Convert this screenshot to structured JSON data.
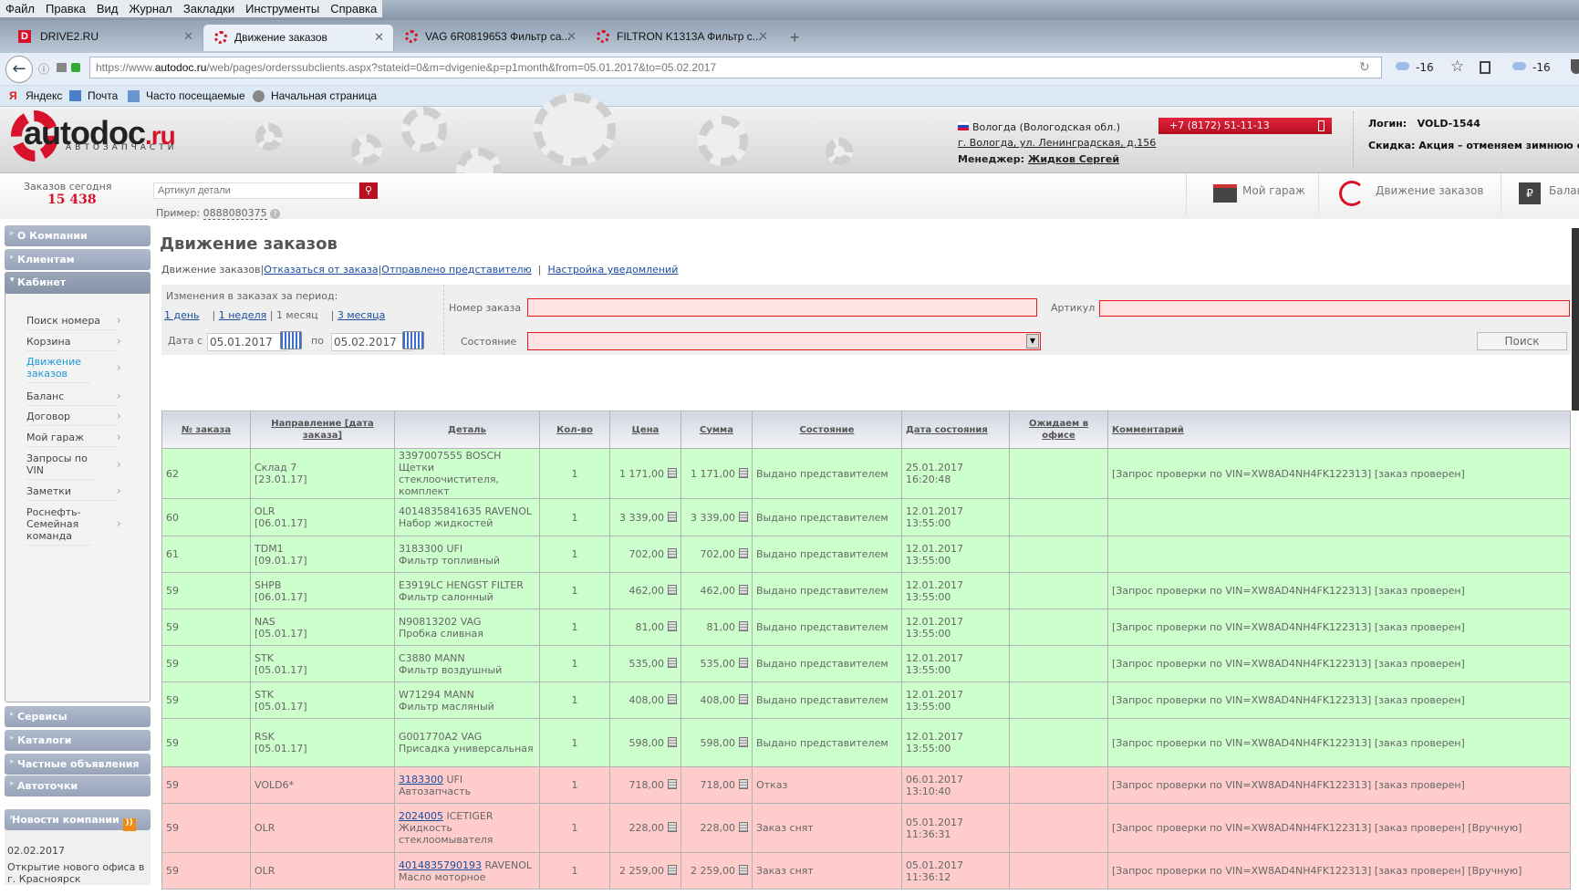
{
  "browser": {
    "menu": [
      "Файл",
      "Правка",
      "Вид",
      "Журнал",
      "Закладки",
      "Инструменты",
      "Справка"
    ],
    "tabs": [
      {
        "label": "DRIVE2.RU",
        "icon": "D"
      },
      {
        "label": "Движение заказов"
      },
      {
        "label": "VAG 6R0819653 Фильтр са..."
      },
      {
        "label": "FILTRON K1313A Фильтр с..."
      }
    ],
    "new_tab": "+",
    "url_prefix": "https://www.",
    "url_host": "autodoc.ru",
    "url_rest": "/web/pages/orderssubclients.aspx?stateid=0&m=dvigenie&p=p1month&from=05.01.2017&to=05.02.2017",
    "weather1": "-16",
    "weather2": "-16",
    "bookmarks": [
      "Яндекс",
      "Почта",
      "Часто посещаемые",
      "Начальная страница"
    ]
  },
  "site": {
    "logo_main": "autodoc",
    "logo_ru": ".ru",
    "logo_sub": "АВТОЗАПЧАСТИ",
    "city": "Вологда (Вологодская обл.)",
    "address": "г. Вологда, ул. Ленинградская, д.156",
    "manager_label": "Менеджер:",
    "manager": "Жидков Сергей",
    "phone": "+7 (8172) 51-11-13",
    "login_label": "Логин:",
    "login": "VOLD-1544",
    "discount_label": "Скидка:",
    "discount": "Акция – отменяем зимнюю спя",
    "orders_today_label": "Заказов сегодня",
    "orders_today": "15 438",
    "search_placeholder": "Артикул детали",
    "example_label": "Пример:",
    "example": "0888080375",
    "top_links": [
      "Мой гараж",
      "Движение заказов",
      "Балан"
    ]
  },
  "sidebar": {
    "sections_top": [
      "О Компании",
      "Клиентам",
      "Кабинет"
    ],
    "items": [
      "Поиск номера",
      "Корзина",
      "Движение заказов",
      "Баланс",
      "Договор",
      "Мой гараж",
      "Запросы по VIN",
      "Заметки",
      "Роснефть-Семейная команда"
    ],
    "sections_bottom": [
      "Сервисы",
      "Каталоги",
      "Частные объявления",
      "Автоточки"
    ],
    "news_title": "Новости компании",
    "news_date": "02.02.2017",
    "news_text": "Открытие нового офиса в г. Красноярск"
  },
  "page": {
    "title": "Движение заказов",
    "subnav": [
      "Движение заказов",
      "Отказаться от заказа",
      "Отправлено представителю",
      "Настройка уведомлений"
    ],
    "period_label": "Изменения в заказах за период:",
    "periods": [
      "1 день",
      "1 неделя",
      "1 месяц",
      "3 месяца"
    ],
    "date_from_label": "Дата с",
    "date_from": "05.01.2017",
    "date_to_label": "по",
    "date_to": "05.02.2017",
    "order_no_label": "Номер заказа",
    "article_label": "Артикул",
    "state_label": "Состояние",
    "search_button": "Поиск"
  },
  "table": {
    "headers": [
      "№ заказа",
      "Направление [дата заказа]",
      "Деталь",
      "Кол-во",
      "Цена",
      "Сумма",
      "Состояние",
      "Дата состояния",
      "Ожидаем в офисе",
      "Комментарий"
    ],
    "rows": [
      {
        "status": "ok",
        "no": "62",
        "dir": "Склад 7",
        "dir_date": "[23.01.17]",
        "part_no": "",
        "part_brand": "3397007555 BOSCH",
        "part_name": "Щетки стеклоочистителя, комплект",
        "qty": "1",
        "price": "1 171,00",
        "sum": "1 171,00",
        "state": "Выдано представителем",
        "date": "25.01.2017",
        "time": "16:20:48",
        "wait": "",
        "comment": "[Запрос проверки по VIN=XW8AD4NH4FK122313] [заказ проверен]"
      },
      {
        "status": "ok",
        "no": "60",
        "dir": "OLR",
        "dir_date": "[06.01.17]",
        "part_no": "",
        "part_brand": "4014835841635 RAVENOL",
        "part_name": "Набор жидкостей",
        "qty": "1",
        "price": "3 339,00",
        "sum": "3 339,00",
        "state": "Выдано представителем",
        "date": "12.01.2017",
        "time": "13:55:00",
        "wait": "",
        "comment": ""
      },
      {
        "status": "ok",
        "no": "61",
        "dir": "TDM1",
        "dir_date": "[09.01.17]",
        "part_no": "",
        "part_brand": "3183300 UFI",
        "part_name": "Фильтр топливный",
        "qty": "1",
        "price": "702,00",
        "sum": "702,00",
        "state": "Выдано представителем",
        "date": "12.01.2017",
        "time": "13:55:00",
        "wait": "",
        "comment": ""
      },
      {
        "status": "ok",
        "no": "59",
        "dir": "SHPB",
        "dir_date": "[06.01.17]",
        "part_no": "",
        "part_brand": "E3919LC HENGST FILTER",
        "part_name": "Фильтр салонный",
        "qty": "1",
        "price": "462,00",
        "sum": "462,00",
        "state": "Выдано представителем",
        "date": "12.01.2017",
        "time": "13:55:00",
        "wait": "",
        "comment": "[Запрос проверки по VIN=XW8AD4NH4FK122313] [заказ проверен]"
      },
      {
        "status": "ok",
        "no": "59",
        "dir": "NAS",
        "dir_date": "[05.01.17]",
        "part_no": "",
        "part_brand": "N90813202 VAG",
        "part_name": "Пробка сливная",
        "qty": "1",
        "price": "81,00",
        "sum": "81,00",
        "state": "Выдано представителем",
        "date": "12.01.2017",
        "time": "13:55:00",
        "wait": "",
        "comment": "[Запрос проверки по VIN=XW8AD4NH4FK122313] [заказ проверен]"
      },
      {
        "status": "ok",
        "no": "59",
        "dir": "STK",
        "dir_date": "[05.01.17]",
        "part_no": "",
        "part_brand": "C3880 MANN",
        "part_name": "Фильтр воздушный",
        "qty": "1",
        "price": "535,00",
        "sum": "535,00",
        "state": "Выдано представителем",
        "date": "12.01.2017",
        "time": "13:55:00",
        "wait": "",
        "comment": "[Запрос проверки по VIN=XW8AD4NH4FK122313] [заказ проверен]"
      },
      {
        "status": "ok",
        "no": "59",
        "dir": "STK",
        "dir_date": "[05.01.17]",
        "part_no": "",
        "part_brand": "W71294 MANN",
        "part_name": "Фильтр масляный",
        "qty": "1",
        "price": "408,00",
        "sum": "408,00",
        "state": "Выдано представителем",
        "date": "12.01.2017",
        "time": "13:55:00",
        "wait": "",
        "comment": "[Запрос проверки по VIN=XW8AD4NH4FK122313] [заказ проверен]"
      },
      {
        "status": "ok",
        "no": "59",
        "dir": "RSK",
        "dir_date": "[05.01.17]",
        "part_no": "",
        "part_brand": "G001770A2 VAG",
        "part_name": "Присадка универсальная",
        "qty": "1",
        "price": "598,00",
        "sum": "598,00",
        "state": "Выдано представителем",
        "date": "12.01.2017",
        "time": "13:55:00",
        "wait": "",
        "comment": "[Запрос проверки по VIN=XW8AD4NH4FK122313] [заказ проверен]"
      },
      {
        "status": "no",
        "no": "59",
        "dir": "VOLD6*",
        "dir_date": "",
        "part_no": "3183300",
        "part_brand": "UFI",
        "part_name": "Автозапчасть",
        "qty": "1",
        "price": "718,00",
        "sum": "718,00",
        "state": "Отказ",
        "date": "06.01.2017",
        "time": "13:10:40",
        "wait": "",
        "comment": "[Запрос проверки по VIN=XW8AD4NH4FK122313] [заказ проверен]"
      },
      {
        "status": "no",
        "no": "59",
        "dir": "OLR",
        "dir_date": "",
        "part_no": "2024005",
        "part_brand": "ICETIGER",
        "part_name": "Жидкость стеклоомывателя",
        "qty": "1",
        "price": "228,00",
        "sum": "228,00",
        "state": "Заказ снят",
        "date": "05.01.2017",
        "time": "11:36:31",
        "wait": "",
        "comment": "[Запрос проверки по VIN=XW8AD4NH4FK122313] [заказ проверен] [Вручную]"
      },
      {
        "status": "no",
        "no": "59",
        "dir": "OLR",
        "dir_date": "",
        "part_no": "4014835790193",
        "part_brand": "RAVENOL",
        "part_name": "Масло моторное",
        "qty": "1",
        "price": "2 259,00",
        "sum": "2 259,00",
        "state": "Заказ снят",
        "date": "05.01.2017",
        "time": "11:36:12",
        "wait": "",
        "comment": "[Запрос проверки по VIN=XW8AD4NH4FK122313] [заказ проверен] [Вручную]"
      }
    ]
  },
  "colors": {
    "ok_row": "#ccffcc",
    "fail_row": "#ffcccc",
    "brand_red": "#d8122a"
  }
}
